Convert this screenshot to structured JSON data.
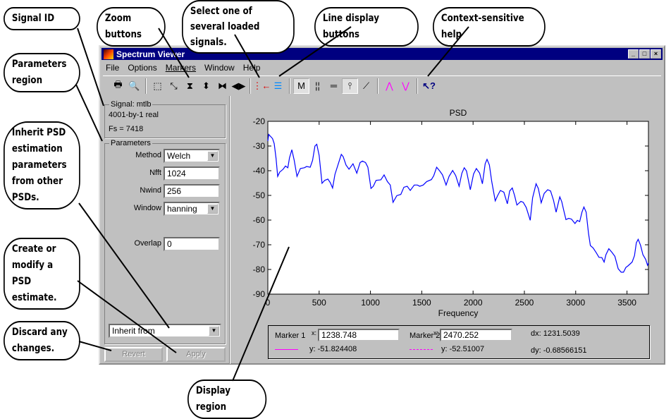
{
  "window": {
    "title": "Spectrum Viewer",
    "controls": [
      "_",
      "□",
      "×"
    ]
  },
  "menu": [
    "File",
    "Options",
    "Markers",
    "Window",
    "Help"
  ],
  "toolbar": [
    {
      "icon": "print-icon",
      "glyph": "🖶"
    },
    {
      "icon": "print-preview-icon",
      "glyph": "🔍"
    },
    {
      "sep": true
    },
    {
      "icon": "zoom-box-icon",
      "glyph": "⬚"
    },
    {
      "icon": "zoom-full-icon",
      "glyph": "⤡"
    },
    {
      "icon": "zoom-in-y-icon",
      "glyph": "⧗"
    },
    {
      "icon": "zoom-out-y-icon",
      "glyph": "⬍"
    },
    {
      "icon": "zoom-in-x-icon",
      "glyph": "⧓"
    },
    {
      "icon": "zoom-out-x-icon",
      "glyph": "◀▶"
    },
    {
      "sep": true
    },
    {
      "icon": "select-signal-icon",
      "glyph": "⋮←"
    },
    {
      "icon": "line-properties-icon",
      "glyph": "☰"
    },
    {
      "sep": true
    },
    {
      "icon": "markers-on-off-icon",
      "glyph": "M",
      "on": true
    },
    {
      "icon": "vertical-markers-icon",
      "glyph": "¦¦"
    },
    {
      "icon": "horizontal-markers-icon",
      "glyph": "═"
    },
    {
      "icon": "track-markers-icon",
      "glyph": "⫯",
      "on": true
    },
    {
      "icon": "slope-markers-icon",
      "glyph": "⟋"
    },
    {
      "sep": true
    },
    {
      "icon": "peaks-icon",
      "glyph": "⋀"
    },
    {
      "icon": "valleys-icon",
      "glyph": "⋁"
    },
    {
      "sep": true
    },
    {
      "icon": "context-help-icon",
      "glyph": "↖?"
    }
  ],
  "signal": {
    "legend": "Signal: mtlb",
    "size": "4001-by-1 real",
    "fs": "Fs = 7418"
  },
  "parameters": {
    "legend": "Parameters",
    "method_label": "Method",
    "method": "Welch",
    "nfft_label": "Nfft",
    "nfft": "1024",
    "nwind_label": "Nwind",
    "nwind": "256",
    "window_label": "Window",
    "window": "hanning",
    "overlap_label": "Overlap",
    "overlap": "0",
    "inherit": "Inherit from"
  },
  "buttons": {
    "revert": "Revert",
    "apply": "Apply"
  },
  "markers": {
    "m1_label": "Marker 1",
    "m1_x_label": "x:",
    "m1_x": "1238.748",
    "m1_y": "y: -51.824408",
    "m2_label": "Marker 2",
    "m2_x_label": "x:",
    "m2_x": "2470.252",
    "m2_y": "y: -52.51007",
    "dx": "dx: 1231.5039",
    "dy": "dy: -0.68566151",
    "line_color": "#ff00ff"
  },
  "callouts": {
    "signal_id": "Signal ID",
    "zoom": "Zoom buttons",
    "select": "Select one of several loaded signals.",
    "line_display": "Line display buttons",
    "help": "Context-sensitive help",
    "params": "Parameters region",
    "inherit": "Inherit PSD estimation parameters from other PSDs.",
    "create": "Create or modify a PSD estimate.",
    "discard": "Discard any changes.",
    "display": "Display region"
  },
  "chart_data": {
    "type": "line",
    "title": "PSD",
    "xlabel": "Frequency",
    "ylabel": "",
    "xlim": [
      0,
      3709
    ],
    "ylim": [
      -90,
      -20
    ],
    "xticks": [
      0,
      500,
      1000,
      1500,
      2000,
      2500,
      3000,
      3500
    ],
    "yticks": [
      -20,
      -30,
      -40,
      -50,
      -60,
      -70,
      -80,
      -90
    ],
    "grid": false,
    "color": "#0000ff",
    "x": [
      0,
      9,
      46,
      62,
      80,
      96,
      115,
      149,
      172,
      195,
      211,
      234,
      257,
      284,
      317,
      356,
      378,
      413,
      436,
      459,
      477,
      500,
      528,
      555,
      585,
      608,
      631,
      654,
      683,
      716,
      734,
      762,
      791,
      830,
      867,
      899,
      922,
      952,
      975,
      1005,
      1028,
      1055,
      1101,
      1133,
      1165,
      1193,
      1220,
      1257,
      1296,
      1326,
      1358,
      1388,
      1427,
      1457,
      1480,
      1514,
      1548,
      1594,
      1617,
      1645,
      1675,
      1702,
      1737,
      1766,
      1801,
      1831,
      1864,
      1891,
      1914,
      1936,
      1973,
      2005,
      2032,
      2064,
      2091,
      2118,
      2136,
      2159,
      2182,
      2216,
      2239,
      2266,
      2300,
      2334,
      2357,
      2382,
      2405,
      2427,
      2466,
      2489,
      2518,
      2557,
      2580,
      2614,
      2636,
      2664,
      2693,
      2727,
      2755,
      2784,
      2809,
      2845,
      2864,
      2882,
      2905,
      2932,
      2959,
      2993,
      3016,
      3039,
      3061,
      3080,
      3102,
      3125,
      3143,
      3170,
      3200,
      3227,
      3255,
      3277,
      3295,
      3323,
      3352,
      3382,
      3414,
      3443,
      3466,
      3489,
      3511,
      3550,
      3573,
      3591,
      3609,
      3632,
      3655,
      3682,
      3700,
      3709
    ],
    "y": [
      -28,
      -25.3,
      -27,
      -29,
      -35,
      -42.3,
      -40.6,
      -39.4,
      -38.1,
      -38.8,
      -34.8,
      -31.5,
      -35.8,
      -42.3,
      -39.1,
      -38.8,
      -38.3,
      -38.6,
      -35.8,
      -30,
      -29.3,
      -33.8,
      -45.1,
      -43.9,
      -43.4,
      -44.8,
      -47,
      -41.5,
      -37.7,
      -33.4,
      -34.3,
      -37.7,
      -39.4,
      -37.2,
      -41,
      -36.7,
      -36.1,
      -36.7,
      -38.6,
      -47.2,
      -46.3,
      -43.9,
      -43.7,
      -41.7,
      -44.4,
      -45.8,
      -52.8,
      -50.1,
      -49.6,
      -46.7,
      -46.3,
      -48,
      -45.8,
      -45.8,
      -46.3,
      -45.8,
      -44.4,
      -43.6,
      -42,
      -38.6,
      -40.1,
      -41.7,
      -45.8,
      -42.3,
      -39.9,
      -42,
      -46.3,
      -41,
      -38.8,
      -40.1,
      -47.7,
      -41.3,
      -39.1,
      -41,
      -45.3,
      -37.2,
      -35.4,
      -37.7,
      -44.4,
      -52.2,
      -50.1,
      -48,
      -48.7,
      -53.4,
      -48.2,
      -47,
      -50.1,
      -53.9,
      -52.4,
      -52.8,
      -54.9,
      -60.1,
      -51,
      -45.3,
      -47.2,
      -53,
      -49.2,
      -47.7,
      -48.2,
      -52,
      -56.8,
      -50.6,
      -52.5,
      -55.8,
      -59.8,
      -59.3,
      -59.6,
      -61.4,
      -60.1,
      -60.6,
      -56.8,
      -54.7,
      -56.8,
      -65.4,
      -70.3,
      -71.3,
      -73.2,
      -75.1,
      -75.2,
      -77,
      -74,
      -71.6,
      -73,
      -74.7,
      -79.7,
      -81.1,
      -81.1,
      -79.2,
      -78.5,
      -77,
      -74.4,
      -69.2,
      -67.8,
      -70.2,
      -74,
      -75.9,
      -78.3,
      -77.3
    ]
  }
}
